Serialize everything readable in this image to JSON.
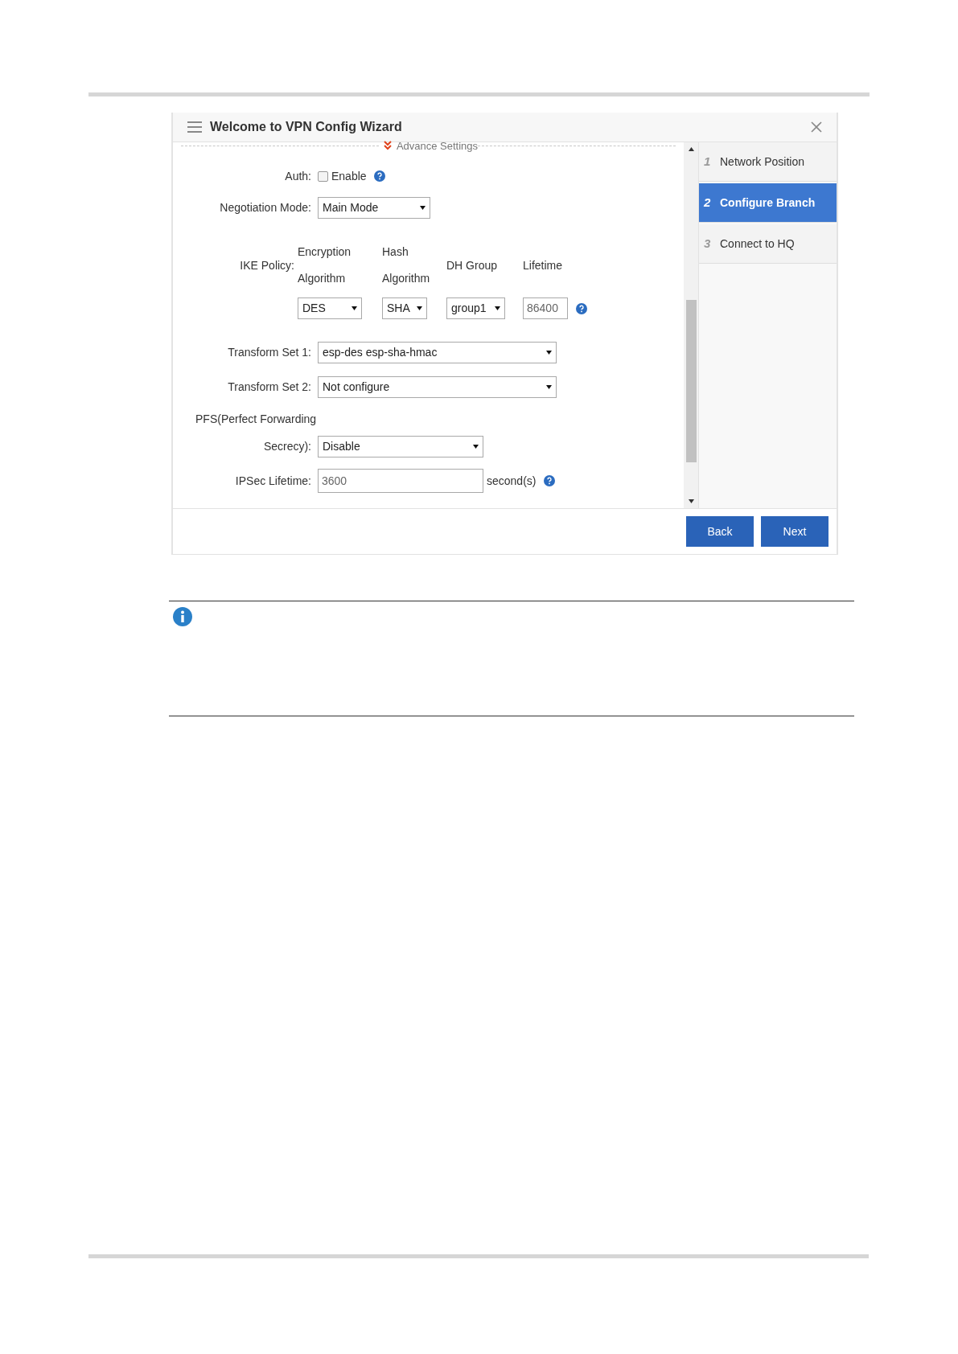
{
  "window": {
    "title": "Welcome to VPN Config Wizard"
  },
  "advance_settings": {
    "label": "Advance Settings"
  },
  "auth": {
    "label": "Auth:",
    "option": "Enable",
    "checked": false
  },
  "negotiation_mode": {
    "label": "Negotiation Mode:",
    "value": "Main Mode"
  },
  "ike_policy": {
    "label": "IKE Policy:",
    "columns": [
      {
        "kind": "select",
        "header": [
          "Encryption",
          "Algorithm"
        ],
        "value": "DES"
      },
      {
        "kind": "select",
        "header": [
          "Hash",
          "Algorithm"
        ],
        "value": "SHA"
      },
      {
        "kind": "select",
        "header": [
          "DH Group"
        ],
        "value": "group1"
      },
      {
        "kind": "input",
        "header": [
          "Lifetime"
        ],
        "value": "86400"
      }
    ]
  },
  "transform_set_1": {
    "label": "Transform Set 1:",
    "value": "esp-des esp-sha-hmac"
  },
  "transform_set_2": {
    "label": "Transform Set 2:",
    "value": "Not configure"
  },
  "pfs": {
    "label_line_1": "PFS(Perfect Forwarding",
    "label_line_2": "Secrecy):",
    "value": "Disable"
  },
  "ipsec_lifetime": {
    "label": "IPSec Lifetime:",
    "value": "3600",
    "unit": "second(s)"
  },
  "steps": [
    {
      "number": "1",
      "label": "Network Position",
      "selected": false
    },
    {
      "number": "2",
      "label": "Configure Branch",
      "selected": true
    },
    {
      "number": "3",
      "label": "Connect to HQ",
      "selected": false
    }
  ],
  "buttons": [
    "Back",
    "Next"
  ]
}
